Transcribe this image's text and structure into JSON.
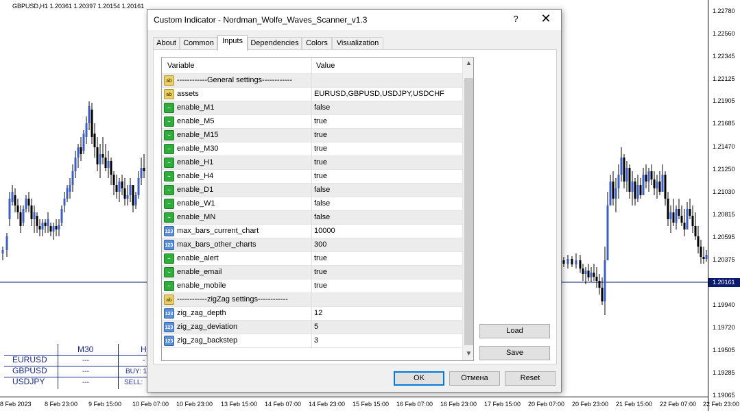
{
  "chart": {
    "title": "GBPUSD,H1  1.20361 1.20397 1.20154 1.20161",
    "current_price": "1.20161",
    "price_ticks": [
      "1.22780",
      "1.22560",
      "1.22345",
      "1.22125",
      "1.21905",
      "1.21685",
      "1.21470",
      "1.21250",
      "1.21030",
      "1.20815",
      "1.20595",
      "1.20375",
      "1.19940",
      "1.19720",
      "1.19505",
      "1.19285",
      "1.19065"
    ],
    "time_ticks": [
      "8 Feb 2023",
      "8 Feb 23:00",
      "9 Feb 15:00",
      "10 Feb 07:00",
      "10 Feb 23:00",
      "13 Feb 15:00",
      "14 Feb 07:00",
      "14 Feb 23:00",
      "15 Feb 15:00",
      "16 Feb 07:00",
      "16 Feb 23:00",
      "17 Feb 15:00",
      "20 Feb 07:00",
      "20 Feb 23:00",
      "21 Feb 15:00",
      "22 Feb 07:00",
      "22 Feb 23:00"
    ]
  },
  "scanner": {
    "headers": [
      "M30",
      "H"
    ],
    "rows": [
      {
        "symbol": "EURUSD",
        "m30": "---",
        "h1": "-"
      },
      {
        "symbol": "GBPUSD",
        "m30": "---",
        "h1": "BUY: 1"
      },
      {
        "symbol": "USDJPY",
        "m30": "---",
        "h1": "SELL: "
      }
    ]
  },
  "dialog": {
    "title": "Custom Indicator - Nordman_Wolfe_Waves_Scanner_v1.3",
    "help": "?",
    "close": "✕",
    "tabs": [
      "About",
      "Common",
      "Inputs",
      "Dependencies",
      "Colors",
      "Visualization"
    ],
    "active_tab": "Inputs",
    "grid_headers": {
      "variable": "Variable",
      "value": "Value"
    },
    "inputs": [
      {
        "icon": "ab",
        "name": "------------General settings------------",
        "value": ""
      },
      {
        "icon": "ab",
        "name": "assets",
        "value": "EURUSD,GBPUSD,USDJPY,USDCHF"
      },
      {
        "icon": "bool",
        "name": "enable_M1",
        "value": "false"
      },
      {
        "icon": "bool",
        "name": "enable_M5",
        "value": "true"
      },
      {
        "icon": "bool",
        "name": "enable_M15",
        "value": "true"
      },
      {
        "icon": "bool",
        "name": "enable_M30",
        "value": "true"
      },
      {
        "icon": "bool",
        "name": "enable_H1",
        "value": "true"
      },
      {
        "icon": "bool",
        "name": "enable_H4",
        "value": "true"
      },
      {
        "icon": "bool",
        "name": "enable_D1",
        "value": "false"
      },
      {
        "icon": "bool",
        "name": "enable_W1",
        "value": "false"
      },
      {
        "icon": "bool",
        "name": "enable_MN",
        "value": "false"
      },
      {
        "icon": "num",
        "name": "max_bars_current_chart",
        "value": "10000"
      },
      {
        "icon": "num",
        "name": "max_bars_other_charts",
        "value": "300"
      },
      {
        "icon": "bool",
        "name": "enable_alert",
        "value": "true"
      },
      {
        "icon": "bool",
        "name": "enable_email",
        "value": "true"
      },
      {
        "icon": "bool",
        "name": "enable_mobile",
        "value": "true"
      },
      {
        "icon": "ab",
        "name": "------------zigZag settings------------",
        "value": ""
      },
      {
        "icon": "num",
        "name": "zig_zag_depth",
        "value": "12"
      },
      {
        "icon": "num",
        "name": "zig_zag_deviation",
        "value": "5"
      },
      {
        "icon": "num",
        "name": "zig_zag_backstep",
        "value": "3"
      }
    ],
    "icon_labels": {
      "ab": "ab",
      "bool": "~",
      "num": "123"
    },
    "buttons": {
      "load": "Load",
      "save": "Save",
      "ok": "OK",
      "cancel": "Отмена",
      "reset": "Reset"
    },
    "colors": {
      "accent": "#0078d7",
      "chart_line": "#0a1b6e",
      "candle_blue": "#3b5fc8"
    }
  }
}
